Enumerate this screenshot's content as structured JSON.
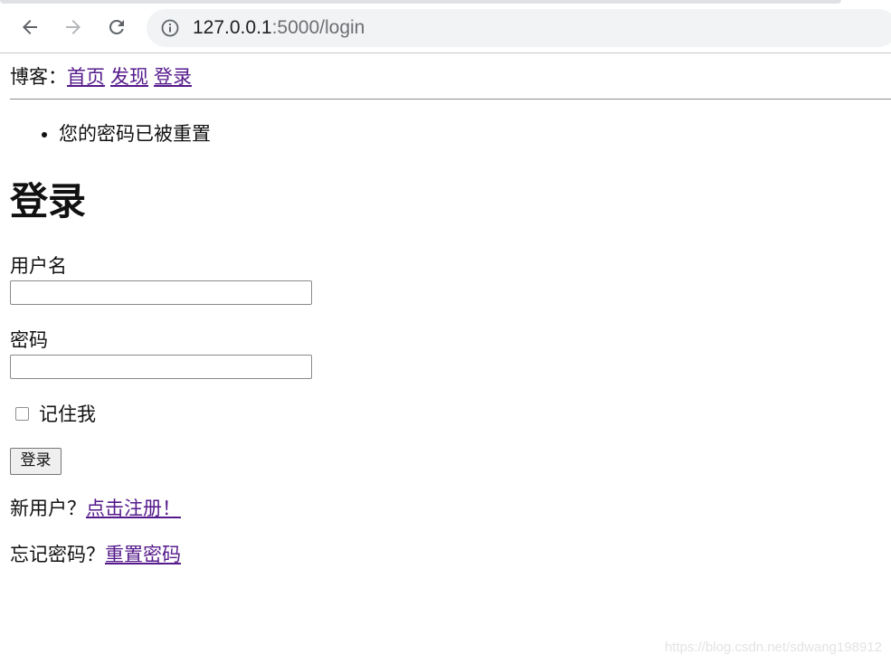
{
  "browser": {
    "url_host": "127.0.0.1",
    "url_rest": ":5000/login",
    "icons": [
      "back-arrow-icon",
      "forward-arrow-icon",
      "reload-icon",
      "info-icon"
    ]
  },
  "nav": {
    "brand": "博客：",
    "links": [
      "首页",
      "发现",
      "登录"
    ]
  },
  "flash_messages": [
    "您的密码已被重置"
  ],
  "form": {
    "title": "登录",
    "username_label": "用户名",
    "username_value": "",
    "password_label": "密码",
    "password_value": "",
    "remember_label": "记住我",
    "remember_checked": false,
    "submit_label": "登录"
  },
  "footer_links": {
    "new_user_text": "新用户？",
    "register_link": "点击注册！",
    "forgot_text": "忘记密码？",
    "reset_link": "重置密码"
  },
  "watermark": "https://blog.csdn.net/sdwang198912",
  "colors": {
    "visited_link": "#551a8b",
    "omnibox_bg": "#f1f3f4"
  }
}
